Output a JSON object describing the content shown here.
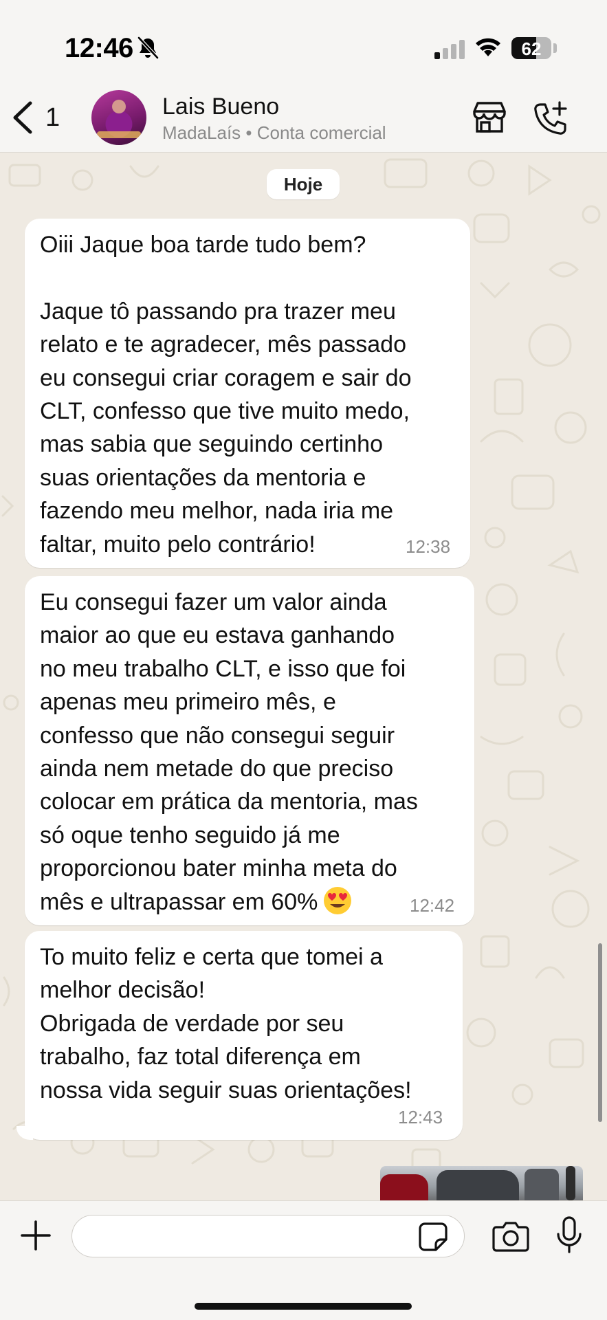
{
  "status_bar": {
    "time": "12:46",
    "battery_level": "62",
    "icons": [
      "bell-off-icon",
      "cellular-signal-icon",
      "wifi-icon",
      "battery-icon"
    ]
  },
  "header": {
    "back_count": "1",
    "contact_name": "Lais Bueno",
    "contact_sub": "MadaLaís  • Conta comercial",
    "icons": [
      "back-chevron-icon",
      "store-icon",
      "add-call-icon"
    ]
  },
  "chat": {
    "day_label": "Hoje",
    "messages": [
      {
        "lines": [
          "Oiii Jaque boa tarde tudo bem?",
          "",
          "Jaque tô passando pra trazer meu",
          "relato e te agradecer, mês passado",
          "eu consegui criar coragem e sair do",
          "CLT, confesso que tive muito medo,",
          "mas sabia que seguindo certinho",
          "suas orientações da mentoria e",
          "fazendo meu melhor, nada iria me",
          "faltar, muito pelo contrário!"
        ],
        "time": "12:38"
      },
      {
        "lines": [
          "Eu consegui fazer um valor ainda",
          "maior ao que eu estava ganhando",
          "no meu trabalho CLT, e isso que foi",
          "apenas meu primeiro mês, e",
          "confesso que não consegui seguir",
          "ainda nem metade do que preciso",
          "colocar em prática da mentoria, mas",
          "só oque tenho seguido já me",
          "proporcionou bater minha meta do",
          "mês e ultrapassar em 60%"
        ],
        "emoji": "heart-eyes-emoji",
        "time": "12:42"
      },
      {
        "lines": [
          "To muito feliz e certa que tomei a",
          "melhor decisão!",
          "Obrigada de verdade por seu",
          "trabalho, faz total diferença em",
          "nossa vida seguir suas orientações!"
        ],
        "time": "12:43"
      }
    ]
  },
  "composer": {
    "input_value": "",
    "icons": [
      "plus-icon",
      "sticker-icon",
      "camera-icon",
      "microphone-icon"
    ]
  },
  "colors": {
    "chat_background": "#efeae2",
    "bubble": "#ffffff",
    "bar_background": "#f6f5f3",
    "timestamp": "#8c8c8c"
  }
}
